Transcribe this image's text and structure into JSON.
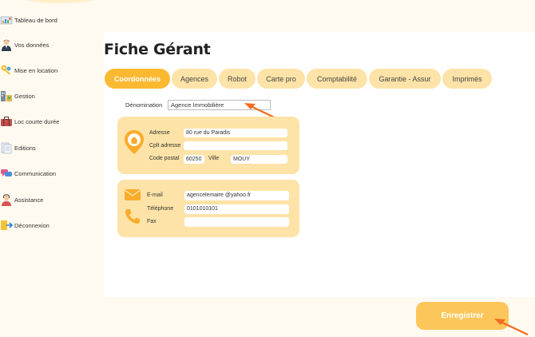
{
  "sidebar": {
    "items": [
      {
        "label": "Tableau de bord",
        "icon": "dashboard-icon"
      },
      {
        "label": "Vos données",
        "icon": "person-icon"
      },
      {
        "label": "Mise en location",
        "icon": "keys-icon"
      },
      {
        "label": "Gestion",
        "icon": "buildings-icon"
      },
      {
        "label": "Loc courte durée",
        "icon": "suitcase-icon"
      },
      {
        "label": "Editions",
        "icon": "documents-icon"
      },
      {
        "label": "Communication",
        "icon": "chat-icon"
      },
      {
        "label": "Assistance",
        "icon": "support-icon"
      },
      {
        "label": "Déconnexion",
        "icon": "logout-icon"
      }
    ]
  },
  "page": {
    "title": "Fiche Gérant"
  },
  "tabs": [
    {
      "label": "Coordonnées",
      "active": true
    },
    {
      "label": "Agences",
      "active": false
    },
    {
      "label": "Robot",
      "active": false
    },
    {
      "label": "Carte pro",
      "active": false
    },
    {
      "label": "Comptabilité",
      "active": false
    },
    {
      "label": "Garantie - Assur",
      "active": false
    },
    {
      "label": "Imprimés",
      "active": false
    }
  ],
  "form": {
    "denomination": {
      "label": "Dénomination",
      "value": "Agence Immobilière"
    },
    "address": {
      "adresse": {
        "label": "Adresse",
        "value": "80 rue du Paradis"
      },
      "cplt": {
        "label": "Cplt adresse",
        "value": ""
      },
      "code_postal": {
        "label": "Code postal",
        "value": "60250"
      },
      "ville": {
        "label": "Ville",
        "value": "MOUY"
      }
    },
    "contact": {
      "email": {
        "label": "E-mail",
        "value": "agencelemaire @yahoo.fr"
      },
      "telephone": {
        "label": "Téléphone",
        "value": "0101010101"
      },
      "fax": {
        "label": "Fax",
        "value": ""
      }
    }
  },
  "actions": {
    "save_label": "Enregistrer"
  },
  "colors": {
    "accent": "#fbb931",
    "tab_bg": "#fde3a7",
    "card_bg": "#fde3a7",
    "arrow": "#f26b21",
    "background": "#fffaf0"
  }
}
